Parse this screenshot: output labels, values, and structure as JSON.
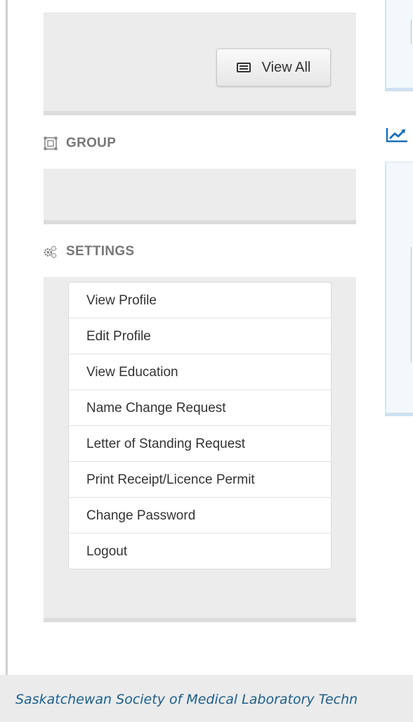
{
  "top_panel": {
    "view_all_label": "View All",
    "view_all_icon": "list-icon"
  },
  "group": {
    "heading": "GROUP",
    "icon": "group-select-icon"
  },
  "settings": {
    "heading": "SETTINGS",
    "icon": "gears-icon",
    "items": [
      {
        "label": "View Profile"
      },
      {
        "label": "Edit Profile"
      },
      {
        "label": "View Education"
      },
      {
        "label": "Name Change Request"
      },
      {
        "label": "Letter of Standing Request"
      },
      {
        "label": "Print Receipt/Licence Permit"
      },
      {
        "label": "Change Password"
      },
      {
        "label": "Logout"
      }
    ]
  },
  "right_column": {
    "icon": "trend-chart-icon",
    "accent_color": "#1a6fb5"
  },
  "footer": {
    "text": "Saskatchewan Society of Medical Laboratory Techn",
    "text_color": "#1d5e8a"
  }
}
